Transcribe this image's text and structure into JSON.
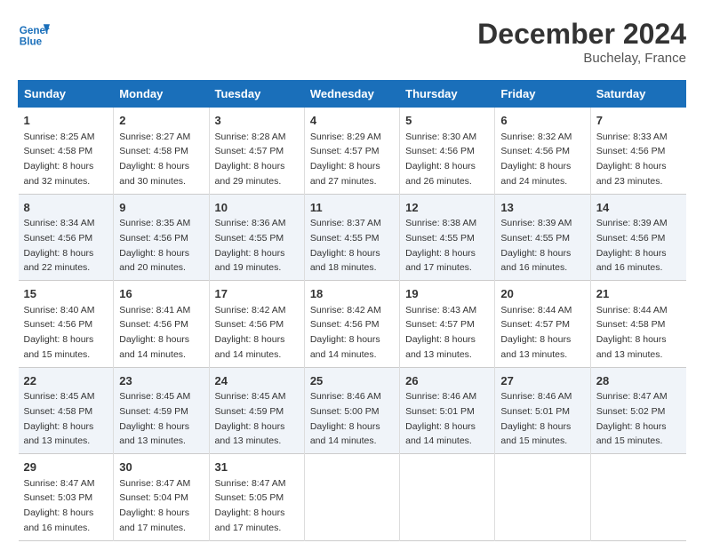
{
  "header": {
    "logo_line1": "General",
    "logo_line2": "Blue",
    "month": "December 2024",
    "location": "Buchelay, France"
  },
  "days_of_week": [
    "Sunday",
    "Monday",
    "Tuesday",
    "Wednesday",
    "Thursday",
    "Friday",
    "Saturday"
  ],
  "weeks": [
    [
      {
        "day": "1",
        "sunrise": "Sunrise: 8:25 AM",
        "sunset": "Sunset: 4:58 PM",
        "daylight": "Daylight: 8 hours and 32 minutes."
      },
      {
        "day": "2",
        "sunrise": "Sunrise: 8:27 AM",
        "sunset": "Sunset: 4:58 PM",
        "daylight": "Daylight: 8 hours and 30 minutes."
      },
      {
        "day": "3",
        "sunrise": "Sunrise: 8:28 AM",
        "sunset": "Sunset: 4:57 PM",
        "daylight": "Daylight: 8 hours and 29 minutes."
      },
      {
        "day": "4",
        "sunrise": "Sunrise: 8:29 AM",
        "sunset": "Sunset: 4:57 PM",
        "daylight": "Daylight: 8 hours and 27 minutes."
      },
      {
        "day": "5",
        "sunrise": "Sunrise: 8:30 AM",
        "sunset": "Sunset: 4:56 PM",
        "daylight": "Daylight: 8 hours and 26 minutes."
      },
      {
        "day": "6",
        "sunrise": "Sunrise: 8:32 AM",
        "sunset": "Sunset: 4:56 PM",
        "daylight": "Daylight: 8 hours and 24 minutes."
      },
      {
        "day": "7",
        "sunrise": "Sunrise: 8:33 AM",
        "sunset": "Sunset: 4:56 PM",
        "daylight": "Daylight: 8 hours and 23 minutes."
      }
    ],
    [
      {
        "day": "8",
        "sunrise": "Sunrise: 8:34 AM",
        "sunset": "Sunset: 4:56 PM",
        "daylight": "Daylight: 8 hours and 22 minutes."
      },
      {
        "day": "9",
        "sunrise": "Sunrise: 8:35 AM",
        "sunset": "Sunset: 4:56 PM",
        "daylight": "Daylight: 8 hours and 20 minutes."
      },
      {
        "day": "10",
        "sunrise": "Sunrise: 8:36 AM",
        "sunset": "Sunset: 4:55 PM",
        "daylight": "Daylight: 8 hours and 19 minutes."
      },
      {
        "day": "11",
        "sunrise": "Sunrise: 8:37 AM",
        "sunset": "Sunset: 4:55 PM",
        "daylight": "Daylight: 8 hours and 18 minutes."
      },
      {
        "day": "12",
        "sunrise": "Sunrise: 8:38 AM",
        "sunset": "Sunset: 4:55 PM",
        "daylight": "Daylight: 8 hours and 17 minutes."
      },
      {
        "day": "13",
        "sunrise": "Sunrise: 8:39 AM",
        "sunset": "Sunset: 4:55 PM",
        "daylight": "Daylight: 8 hours and 16 minutes."
      },
      {
        "day": "14",
        "sunrise": "Sunrise: 8:39 AM",
        "sunset": "Sunset: 4:56 PM",
        "daylight": "Daylight: 8 hours and 16 minutes."
      }
    ],
    [
      {
        "day": "15",
        "sunrise": "Sunrise: 8:40 AM",
        "sunset": "Sunset: 4:56 PM",
        "daylight": "Daylight: 8 hours and 15 minutes."
      },
      {
        "day": "16",
        "sunrise": "Sunrise: 8:41 AM",
        "sunset": "Sunset: 4:56 PM",
        "daylight": "Daylight: 8 hours and 14 minutes."
      },
      {
        "day": "17",
        "sunrise": "Sunrise: 8:42 AM",
        "sunset": "Sunset: 4:56 PM",
        "daylight": "Daylight: 8 hours and 14 minutes."
      },
      {
        "day": "18",
        "sunrise": "Sunrise: 8:42 AM",
        "sunset": "Sunset: 4:56 PM",
        "daylight": "Daylight: 8 hours and 14 minutes."
      },
      {
        "day": "19",
        "sunrise": "Sunrise: 8:43 AM",
        "sunset": "Sunset: 4:57 PM",
        "daylight": "Daylight: 8 hours and 13 minutes."
      },
      {
        "day": "20",
        "sunrise": "Sunrise: 8:44 AM",
        "sunset": "Sunset: 4:57 PM",
        "daylight": "Daylight: 8 hours and 13 minutes."
      },
      {
        "day": "21",
        "sunrise": "Sunrise: 8:44 AM",
        "sunset": "Sunset: 4:58 PM",
        "daylight": "Daylight: 8 hours and 13 minutes."
      }
    ],
    [
      {
        "day": "22",
        "sunrise": "Sunrise: 8:45 AM",
        "sunset": "Sunset: 4:58 PM",
        "daylight": "Daylight: 8 hours and 13 minutes."
      },
      {
        "day": "23",
        "sunrise": "Sunrise: 8:45 AM",
        "sunset": "Sunset: 4:59 PM",
        "daylight": "Daylight: 8 hours and 13 minutes."
      },
      {
        "day": "24",
        "sunrise": "Sunrise: 8:45 AM",
        "sunset": "Sunset: 4:59 PM",
        "daylight": "Daylight: 8 hours and 13 minutes."
      },
      {
        "day": "25",
        "sunrise": "Sunrise: 8:46 AM",
        "sunset": "Sunset: 5:00 PM",
        "daylight": "Daylight: 8 hours and 14 minutes."
      },
      {
        "day": "26",
        "sunrise": "Sunrise: 8:46 AM",
        "sunset": "Sunset: 5:01 PM",
        "daylight": "Daylight: 8 hours and 14 minutes."
      },
      {
        "day": "27",
        "sunrise": "Sunrise: 8:46 AM",
        "sunset": "Sunset: 5:01 PM",
        "daylight": "Daylight: 8 hours and 15 minutes."
      },
      {
        "day": "28",
        "sunrise": "Sunrise: 8:47 AM",
        "sunset": "Sunset: 5:02 PM",
        "daylight": "Daylight: 8 hours and 15 minutes."
      }
    ],
    [
      {
        "day": "29",
        "sunrise": "Sunrise: 8:47 AM",
        "sunset": "Sunset: 5:03 PM",
        "daylight": "Daylight: 8 hours and 16 minutes."
      },
      {
        "day": "30",
        "sunrise": "Sunrise: 8:47 AM",
        "sunset": "Sunset: 5:04 PM",
        "daylight": "Daylight: 8 hours and 17 minutes."
      },
      {
        "day": "31",
        "sunrise": "Sunrise: 8:47 AM",
        "sunset": "Sunset: 5:05 PM",
        "daylight": "Daylight: 8 hours and 17 minutes."
      },
      null,
      null,
      null,
      null
    ]
  ]
}
